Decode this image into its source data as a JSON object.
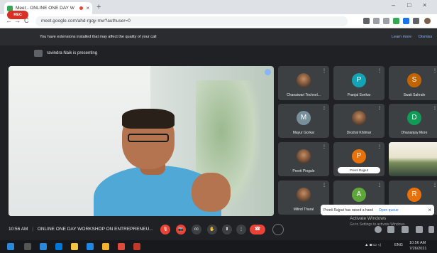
{
  "browser": {
    "tab_title": "Meet - ONLINE ONE DAY W",
    "tab_close": "×",
    "new_tab": "+",
    "minimize": "–",
    "maximize": "□",
    "close": "×",
    "back": "←",
    "forward": "→",
    "reload": "C",
    "url": "meet.google.com/ahd-rgqy-mw?authuser=0"
  },
  "infobar": {
    "rec_label": "REC",
    "message": "You have extensions installed that may affect the quality of your call",
    "learn_more": "Learn more",
    "dismiss": "Dismiss"
  },
  "presenting": {
    "text": "ravindra Naik is presenting"
  },
  "participants": [
    {
      "name": "Chanaiwari Technol...",
      "type": "photo"
    },
    {
      "name": "Pranjal Sonkar",
      "type": "letter",
      "letter": "P",
      "color": "#12a4b4"
    },
    {
      "name": "Swati Sahrale",
      "type": "letter",
      "letter": "S",
      "color": "#c26401"
    },
    {
      "name": "Mayur Gorkar",
      "type": "letter",
      "letter": "M",
      "color": "#78909c"
    },
    {
      "name": "Dixshal Khilmar",
      "type": "photo"
    },
    {
      "name": "Dhananjay More",
      "type": "letter",
      "letter": "D",
      "color": "#129a57"
    },
    {
      "name": "Preeti Pingale",
      "type": "photo"
    },
    {
      "name": "Preeti Rajput",
      "type": "pill",
      "letter": "P",
      "color": "#e8710a"
    },
    {
      "name": "",
      "type": "screen"
    },
    {
      "name": "Milind Tharal",
      "type": "photo"
    },
    {
      "name": "",
      "type": "letter",
      "letter": "A",
      "color": "#5fa73a"
    },
    {
      "name": "",
      "type": "letter",
      "letter": "R",
      "color": "#e8710a"
    }
  ],
  "toast": {
    "text": "Preeti Rajput has raised a hand",
    "action": "Open queue",
    "close": "×"
  },
  "meeting": {
    "time": "10:56 AM",
    "separator": "|",
    "title": "ONLINE ONE DAY WORKSHOP ON ENTREPRENEU..."
  },
  "controls": {
    "mic": "🎙",
    "cam": "📷",
    "cc": "cc",
    "present": "⬆",
    "hand": "✋",
    "more": "⋮",
    "end": "☎"
  },
  "windows": {
    "activate": "Activate Windows",
    "activate_sub": "Go to Settings to activate Windows."
  },
  "taskbar": {
    "lang": "ENG",
    "time": "10:56 AM",
    "date": "7/26/2021"
  },
  "colors": {
    "rec": "#d93025",
    "end_call": "#ea4335",
    "link": "#8ab4f8"
  }
}
